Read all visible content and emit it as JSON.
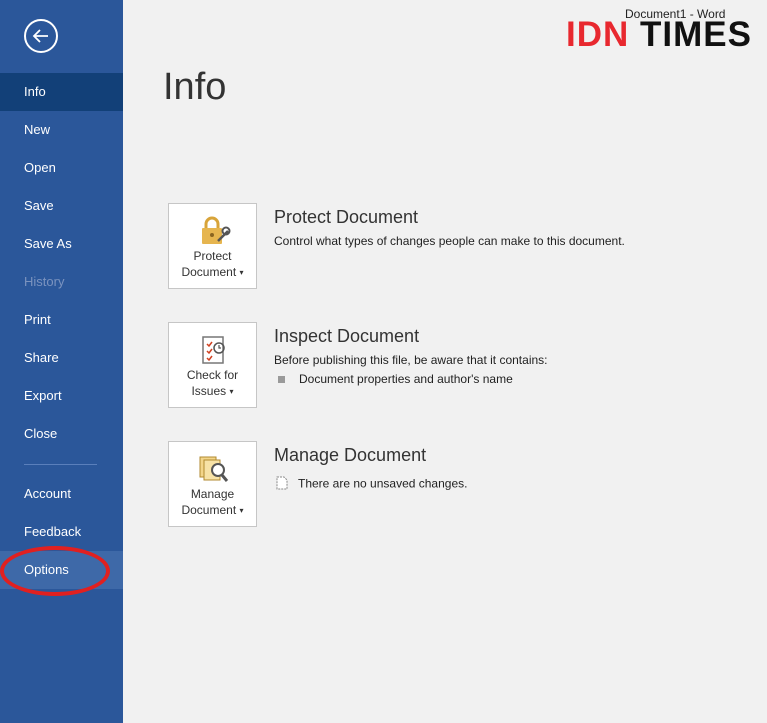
{
  "window": {
    "title": "Document1  -  Word"
  },
  "logo": {
    "idn": "IDN",
    "times": "TIMES"
  },
  "sidebar": {
    "items_top": [
      {
        "label": "Info",
        "state": "active"
      },
      {
        "label": "New",
        "state": "normal"
      },
      {
        "label": "Open",
        "state": "normal"
      },
      {
        "label": "Save",
        "state": "normal"
      },
      {
        "label": "Save As",
        "state": "normal"
      },
      {
        "label": "History",
        "state": "disabled"
      },
      {
        "label": "Print",
        "state": "normal"
      },
      {
        "label": "Share",
        "state": "normal"
      },
      {
        "label": "Export",
        "state": "normal"
      },
      {
        "label": "Close",
        "state": "normal"
      }
    ],
    "items_bottom": [
      {
        "label": "Account"
      },
      {
        "label": "Feedback"
      },
      {
        "label": "Options"
      }
    ]
  },
  "main": {
    "title": "Info",
    "sections": [
      {
        "button_line1": "Protect",
        "button_line2": "Document",
        "icon": "lock-icon",
        "title": "Protect Document",
        "description": "Control what types of changes people can make to this document."
      },
      {
        "button_line1": "Check for",
        "button_line2": "Issues",
        "icon": "checklist-icon",
        "title": "Inspect Document",
        "description": "Before publishing this file, be aware that it contains:",
        "bullet": "Document properties and author's name"
      },
      {
        "button_line1": "Manage",
        "button_line2": "Document",
        "icon": "manage-document-icon",
        "title": "Manage Document",
        "note": "There are no unsaved changes."
      }
    ]
  },
  "colors": {
    "sidebar": "#2b579a",
    "active": "#124078",
    "highlight_ellipse": "#e02020",
    "logo_red": "#e8282f"
  }
}
